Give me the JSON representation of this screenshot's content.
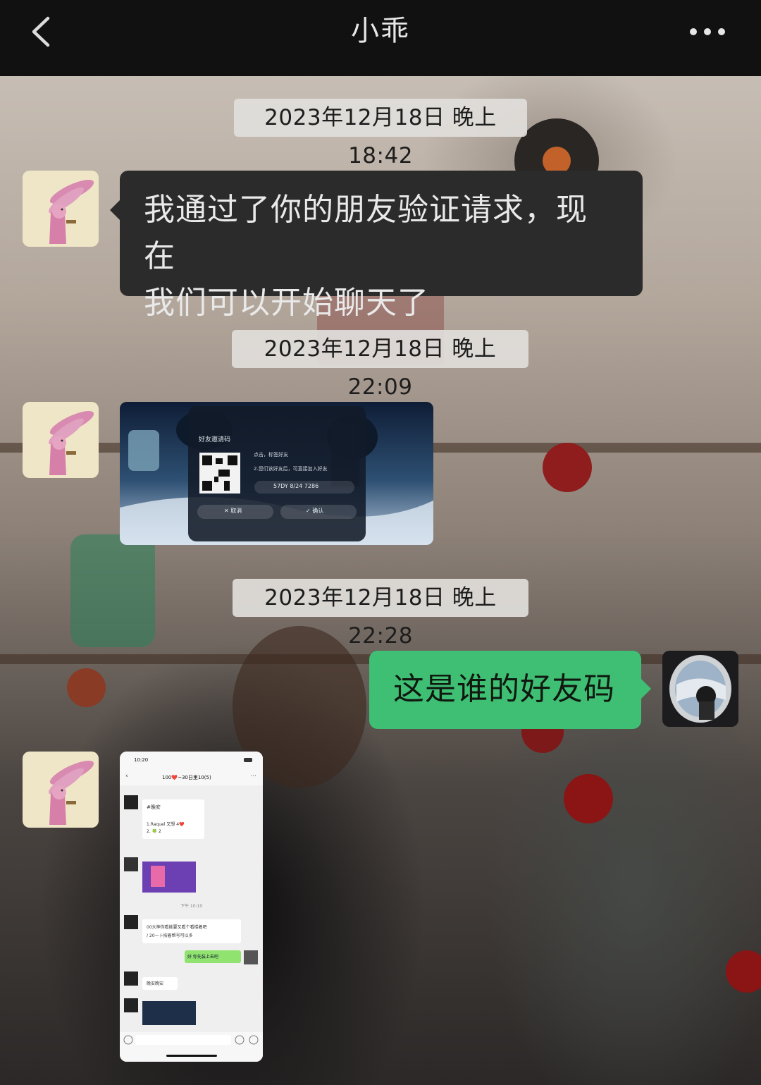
{
  "header": {
    "title": "小乖",
    "back_icon": "chevron-left-icon",
    "more_icon": "more-horizontal-icon"
  },
  "messages": [
    {
      "type": "timestamp",
      "text": "2023年12月18日 晚上18:42"
    },
    {
      "type": "text",
      "direction": "incoming",
      "lines": [
        "我通过了你的朋友验证请求，现在",
        "我们可以开始聊天了"
      ]
    },
    {
      "type": "timestamp",
      "text": "2023年12月18日 晚上22:09"
    },
    {
      "type": "image",
      "direction": "incoming",
      "content": {
        "dialog_title": "好友邀请码",
        "item1": "点击，标签好友",
        "item2": "2.您们该好友后，可直接加入好友",
        "code": "57DY 8/24 7286",
        "cancel": "取消",
        "confirm": "确认"
      }
    },
    {
      "type": "timestamp",
      "text": "2023年12月18日 晚上22:28"
    },
    {
      "type": "text",
      "direction": "outgoing",
      "lines": [
        "这是谁的好友码"
      ]
    },
    {
      "type": "image",
      "direction": "incoming",
      "content": {
        "status_time": "10:20",
        "chat_title": "100❤️~30日里10(5)",
        "bubble1": "#晚安",
        "bubble1b": "1.Raquel 又想 4❤️",
        "bubble1c": "2. 🍀 2",
        "divider": "下午 10:10",
        "bubble3": "00大神你看能要又看个看楼着吧",
        "bubble3b": "/ 20一卜按着帮号可以多",
        "mine": "好 你先装上去吧",
        "bubble4": "晚安晚安"
      }
    }
  ],
  "colors": {
    "header_bg": "#111111",
    "incoming_bubble": "#2b2b2b",
    "outgoing_bubble": "#3fbf73",
    "timestamp_bg": "#e1dedb"
  }
}
